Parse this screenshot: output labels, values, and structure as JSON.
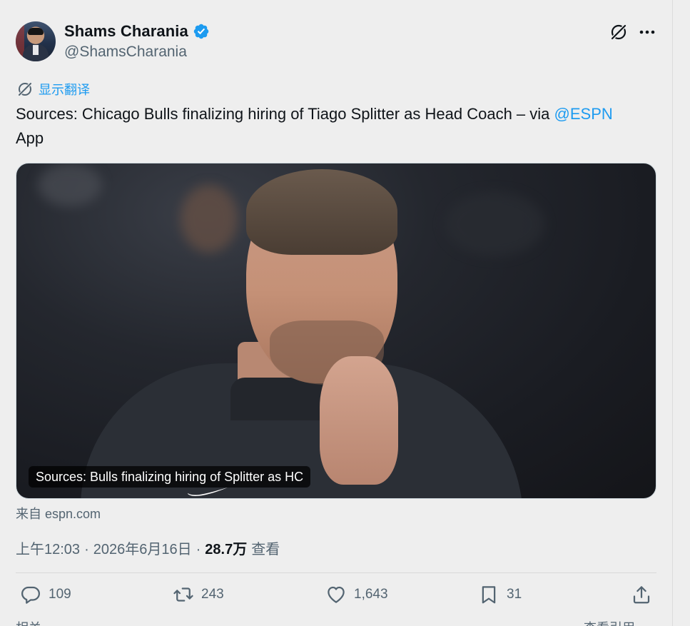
{
  "author": {
    "display_name": "Shams Charania",
    "handle": "@ShamsCharania",
    "verified": true,
    "verified_color": "#1d9bf0"
  },
  "header_icons": [
    "grok-icon",
    "more-icon"
  ],
  "translate": {
    "label": "显示翻译",
    "icon": "translate-icon"
  },
  "tweet": {
    "text_before": "Sources: Chicago Bulls finalizing hiring of Tiago Splitter as Head Coach – via ",
    "mention": "@ESPN",
    "text_after": " App"
  },
  "media": {
    "caption": "Sources: Bulls finalizing hiring of Splitter as HC"
  },
  "source": "来自 espn.com",
  "meta": {
    "time": "上午12:03",
    "separator1": "·",
    "date": "2026年6月16日",
    "separator2": "·",
    "views_count": "28.7万",
    "views_label": "查看"
  },
  "actions": {
    "reply": {
      "count": "109",
      "icon": "reply-icon"
    },
    "retweet": {
      "count": "243",
      "icon": "retweet-icon"
    },
    "like": {
      "count": "1,643",
      "icon": "heart-icon"
    },
    "bookmark": {
      "count": "31",
      "icon": "bookmark-icon"
    },
    "share": {
      "icon": "share-icon"
    }
  },
  "footer_partial": {
    "left": "相关",
    "right": "查看引用 ›"
  },
  "colors": {
    "accent": "#1d9bf0",
    "text_primary": "#0f1419",
    "text_secondary": "#536471",
    "background": "#eeeeee"
  }
}
